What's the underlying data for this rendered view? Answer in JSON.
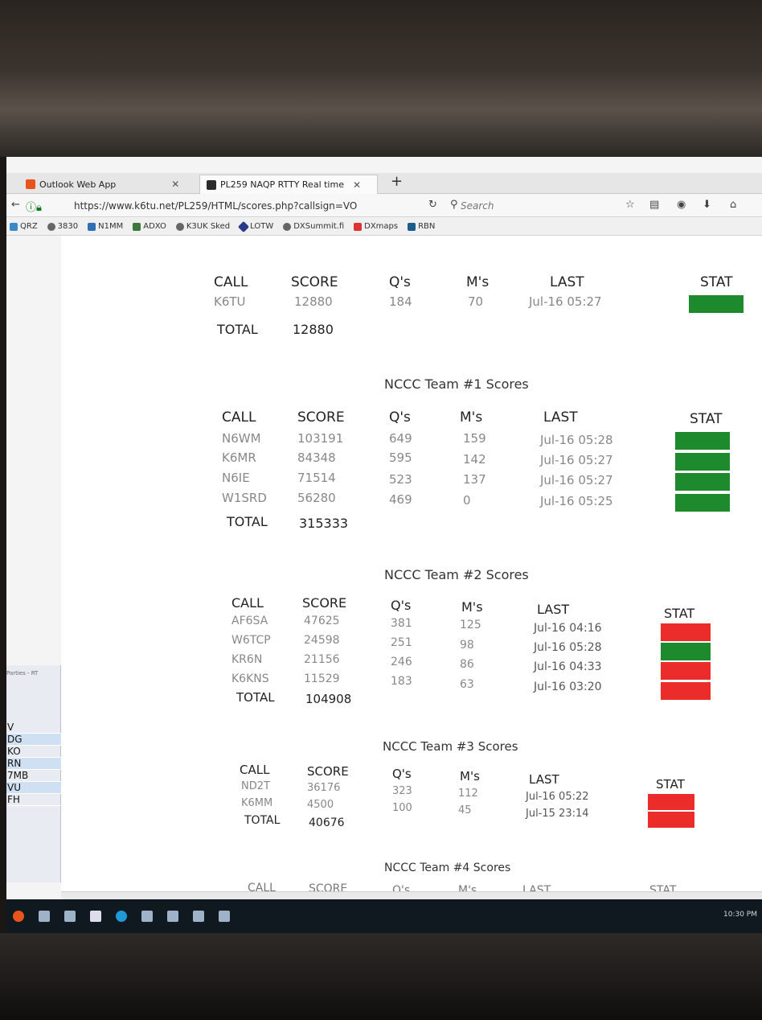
{
  "browser": {
    "tabs": [
      {
        "label": "Outlook Web App",
        "favicon": "outlook-icon",
        "color": "#e8541c"
      },
      {
        "label": "PL259 NAQP RTTY Real time",
        "favicon": "pl259-icon",
        "color": "#2b2b2b"
      }
    ],
    "url": "https://www.k6tu.net/PL259/HTML/scores.php?callsign=VO",
    "search_placeholder": "Search",
    "bookmarks": [
      "QRZ",
      "3830",
      "N1MM",
      "ADXO",
      "K3UK Sked",
      "LOTW",
      "DXSummit.fi",
      "DXmaps",
      "RBN"
    ]
  },
  "side_app": {
    "title": "Parties - RT",
    "items": [
      "V",
      "DG",
      "KO",
      "RN",
      "7MB",
      "VU",
      "FH"
    ]
  },
  "headers": {
    "call": "CALL",
    "score": "SCORE",
    "qs": "Q's",
    "ms": "M's",
    "last": "LAST",
    "stat": "STAT",
    "total": "TOTAL"
  },
  "my_station": {
    "rows": [
      {
        "call": "K6TU",
        "score": "12880",
        "qs": "184",
        "ms": "70",
        "last": "Jul-16 05:27",
        "stat": "green"
      }
    ],
    "total": "12880"
  },
  "teams": [
    {
      "title": "NCCC Team #1 Scores",
      "rows": [
        {
          "call": "N6WM",
          "score": "103191",
          "qs": "649",
          "ms": "159",
          "last": "Jul-16 05:28",
          "stat": "green"
        },
        {
          "call": "K6MR",
          "score": "84348",
          "qs": "595",
          "ms": "142",
          "last": "Jul-16 05:27",
          "stat": "green"
        },
        {
          "call": "N6IE",
          "score": "71514",
          "qs": "523",
          "ms": "137",
          "last": "Jul-16 05:27",
          "stat": "green"
        },
        {
          "call": "W1SRD",
          "score": "56280",
          "qs": "469",
          "ms": "0",
          "last": "Jul-16 05:25",
          "stat": "green"
        }
      ],
      "total": "315333"
    },
    {
      "title": "NCCC Team #2 Scores",
      "rows": [
        {
          "call": "AF6SA",
          "score": "47625",
          "qs": "381",
          "ms": "125",
          "last": "Jul-16 04:16",
          "stat": "red"
        },
        {
          "call": "W6TCP",
          "score": "24598",
          "qs": "251",
          "ms": "98",
          "last": "Jul-16 05:28",
          "stat": "green"
        },
        {
          "call": "KR6N",
          "score": "21156",
          "qs": "246",
          "ms": "86",
          "last": "Jul-16 04:33",
          "stat": "red"
        },
        {
          "call": "K6KNS",
          "score": "11529",
          "qs": "183",
          "ms": "63",
          "last": "Jul-16 03:20",
          "stat": "red"
        }
      ],
      "total": "104908"
    },
    {
      "title": "NCCC Team #3 Scores",
      "rows": [
        {
          "call": "ND2T",
          "score": "36176",
          "qs": "323",
          "ms": "112",
          "last": "Jul-16 05:22",
          "stat": "red"
        },
        {
          "call": "K6MM",
          "score": "4500",
          "qs": "100",
          "ms": "45",
          "last": "Jul-15 23:14",
          "stat": "red"
        }
      ],
      "total": "40676"
    },
    {
      "title": "NCCC Team #4 Scores",
      "rows": [],
      "total": ""
    }
  ],
  "taskbar": {
    "clock": "10:30 PM"
  }
}
